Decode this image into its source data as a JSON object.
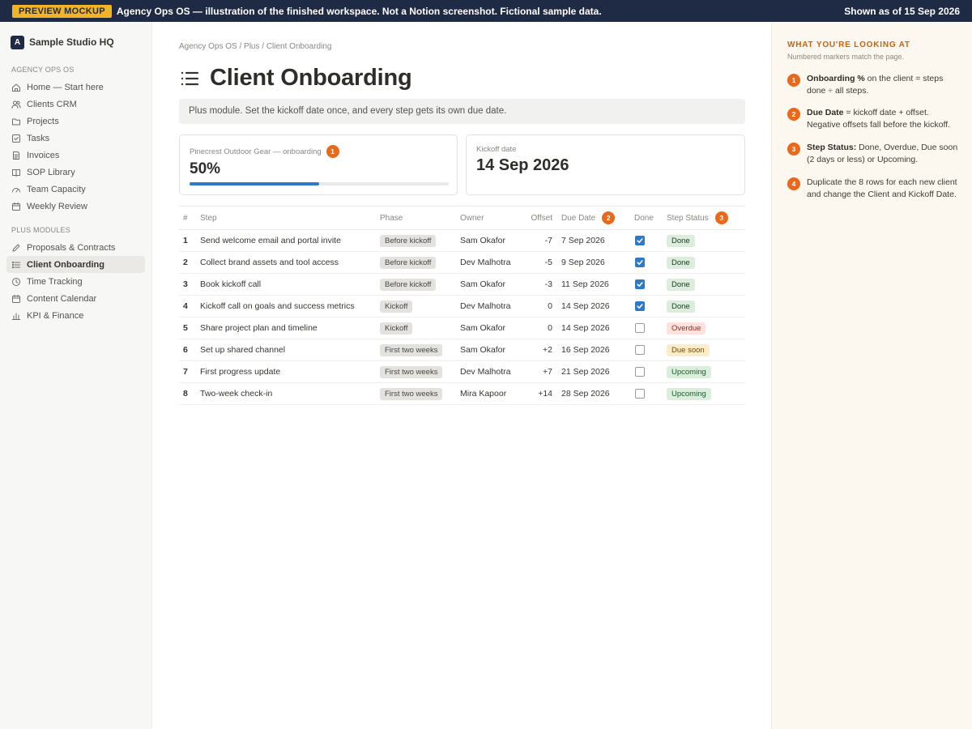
{
  "banner": {
    "badge": "PREVIEW MOCKUP",
    "message": "Agency Ops OS — illustration of the finished workspace. Not a Notion screenshot. Fictional sample data.",
    "as_of": "Shown as of 15 Sep 2026"
  },
  "sidebar": {
    "workspace_initial": "A",
    "workspace_name": "Sample Studio HQ",
    "section1_label": "AGENCY OPS OS",
    "section1_items": [
      {
        "label": "Home — Start here",
        "icon": "home-icon"
      },
      {
        "label": "Clients CRM",
        "icon": "users-icon"
      },
      {
        "label": "Projects",
        "icon": "folder-icon"
      },
      {
        "label": "Tasks",
        "icon": "checkbox-icon"
      },
      {
        "label": "Invoices",
        "icon": "document-icon"
      },
      {
        "label": "SOP Library",
        "icon": "book-icon"
      },
      {
        "label": "Team Capacity",
        "icon": "gauge-icon"
      },
      {
        "label": "Weekly Review",
        "icon": "calendar-icon"
      }
    ],
    "section2_label": "PLUS MODULES",
    "section2_items": [
      {
        "label": "Proposals & Contracts",
        "icon": "pen-icon",
        "active": false
      },
      {
        "label": "Client Onboarding",
        "icon": "list-icon",
        "active": true
      },
      {
        "label": "Time Tracking",
        "icon": "clock-icon",
        "active": false
      },
      {
        "label": "Content Calendar",
        "icon": "calendar-icon",
        "active": false
      },
      {
        "label": "KPI & Finance",
        "icon": "bar-chart-icon",
        "active": false
      }
    ]
  },
  "page": {
    "breadcrumb": "Agency Ops OS / Plus / Client Onboarding",
    "title_icon": "list-icon",
    "title": "Client Onboarding",
    "callout": "Plus module. Set the kickoff date once, and every step gets its own due date."
  },
  "cards": {
    "onboarding_label": "Pinecrest Outdoor Gear — onboarding",
    "onboarding_marker": "1",
    "onboarding_value": "50%",
    "onboarding_progress": 0.5,
    "kickoff_label": "Kickoff date",
    "kickoff_value": "14 Sep 2026"
  },
  "table": {
    "headers": {
      "num": "#",
      "step": "Step",
      "phase": "Phase",
      "owner": "Owner",
      "offset": "Offset",
      "due": "Due Date",
      "due_marker": "2",
      "done": "Done",
      "status": "Step Status",
      "status_marker": "3"
    },
    "rows": [
      {
        "num": "1",
        "step": "Send welcome email and portal invite",
        "phase": "Before kickoff",
        "owner": "Sam Okafor",
        "offset": "-7",
        "due": "7 Sep 2026",
        "done": true,
        "status": "Done"
      },
      {
        "num": "2",
        "step": "Collect brand assets and tool access",
        "phase": "Before kickoff",
        "owner": "Dev Malhotra",
        "offset": "-5",
        "due": "9 Sep 2026",
        "done": true,
        "status": "Done"
      },
      {
        "num": "3",
        "step": "Book kickoff call",
        "phase": "Before kickoff",
        "owner": "Sam Okafor",
        "offset": "-3",
        "due": "11 Sep 2026",
        "done": true,
        "status": "Done"
      },
      {
        "num": "4",
        "step": "Kickoff call on goals and success metrics",
        "phase": "Kickoff",
        "owner": "Dev Malhotra",
        "offset": "0",
        "due": "14 Sep 2026",
        "done": true,
        "status": "Done"
      },
      {
        "num": "5",
        "step": "Share project plan and timeline",
        "phase": "Kickoff",
        "owner": "Sam Okafor",
        "offset": "0",
        "due": "14 Sep 2026",
        "done": false,
        "status": "Overdue"
      },
      {
        "num": "6",
        "step": "Set up shared channel",
        "phase": "First two weeks",
        "owner": "Sam Okafor",
        "offset": "+2",
        "due": "16 Sep 2026",
        "done": false,
        "status": "Due soon"
      },
      {
        "num": "7",
        "step": "First progress update",
        "phase": "First two weeks",
        "owner": "Dev Malhotra",
        "offset": "+7",
        "due": "21 Sep 2026",
        "done": false,
        "status": "Upcoming"
      },
      {
        "num": "8",
        "step": "Two-week check-in",
        "phase": "First two weeks",
        "owner": "Mira Kapoor",
        "offset": "+14",
        "due": "28 Sep 2026",
        "done": false,
        "status": "Upcoming"
      }
    ]
  },
  "status_colors": {
    "Done": {
      "bg": "#dbeddb",
      "fg": "#1c3829"
    },
    "Overdue": {
      "bg": "#ffe2dd",
      "fg": "#a1271b"
    },
    "Due soon": {
      "bg": "#fdecc8",
      "fg": "#6b4a0e"
    },
    "Upcoming": {
      "bg": "#dbeddb",
      "fg": "#1c5b2e"
    }
  },
  "colors": {
    "accent_blue": "#2f79c9",
    "marker_orange": "#e8681c",
    "banner_bg": "#1f2a44",
    "badge_yellow": "#f2b427"
  },
  "right_panel": {
    "title": "WHAT YOU'RE LOOKING AT",
    "subtitle": "Numbered markers match the page.",
    "notes": [
      {
        "marker": "1",
        "bold": "Onboarding %",
        "text": " on the client = steps done ÷ all steps."
      },
      {
        "marker": "2",
        "bold": "Due Date",
        "text": " = kickoff date + offset. Negative offsets fall before the kickoff."
      },
      {
        "marker": "3",
        "bold": "Step Status:",
        "text": " Done, Overdue, Due soon (2 days or less) or Upcoming."
      },
      {
        "marker": "4",
        "bold": "",
        "text": "Duplicate the 8 rows for each new client and change the Client and Kickoff Date."
      }
    ]
  }
}
